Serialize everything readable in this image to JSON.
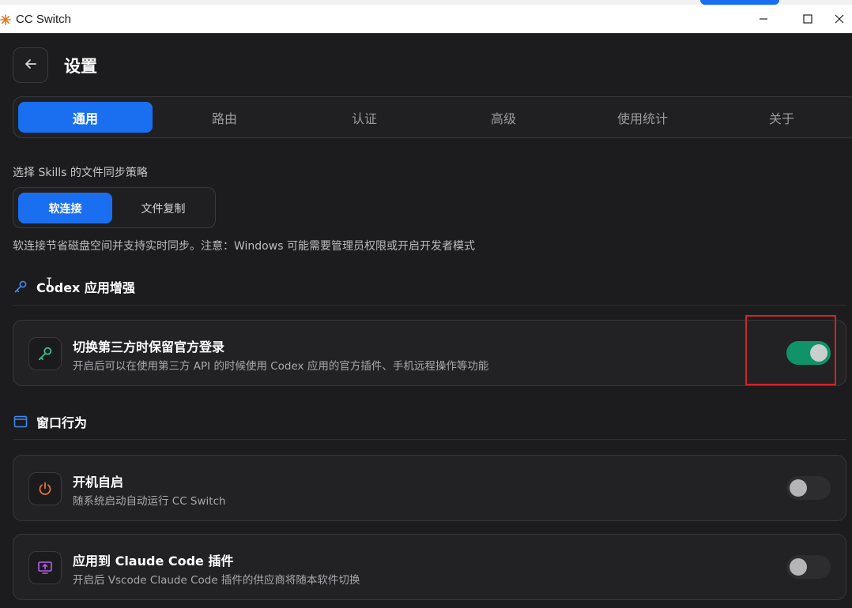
{
  "window": {
    "title": "CC Switch"
  },
  "header": {
    "title": "设置"
  },
  "tabs": [
    {
      "label": "通用",
      "active": true
    },
    {
      "label": "路由",
      "active": false
    },
    {
      "label": "认证",
      "active": false
    },
    {
      "label": "高级",
      "active": false
    },
    {
      "label": "使用统计",
      "active": false
    },
    {
      "label": "关于",
      "active": false
    }
  ],
  "skills_sync": {
    "label": "选择 Skills 的文件同步策略",
    "options": [
      {
        "label": "软连接",
        "selected": true
      },
      {
        "label": "文件复制",
        "selected": false
      }
    ],
    "note": "软连接节省磁盘空间并支持实时同步。注意：Windows 可能需要管理员权限或开启开发者模式"
  },
  "codex_section": {
    "title": "Codex 应用增强",
    "icon": "key-icon",
    "items": [
      {
        "title": "切换第三方时保留官方登录",
        "description": "开启后可以在使用第三方 API 的时候使用 Codex 应用的官方插件、手机远程操作等功能",
        "icon": "key-icon",
        "enabled": true
      }
    ]
  },
  "window_section": {
    "title": "窗口行为",
    "icon": "window-icon",
    "items": [
      {
        "title": "开机自启",
        "description": "随系统启动自动运行 CC Switch",
        "icon": "power-icon",
        "enabled": false
      },
      {
        "title": "应用到 Claude Code 插件",
        "description": "开启后 Vscode Claude Code 插件的供应商将随本软件切换",
        "icon": "monitor-upload-icon",
        "enabled": false
      }
    ]
  },
  "colors": {
    "accent": "#1a6ff0",
    "toggle_on": "#11936a",
    "highlight": "#d2232a",
    "background": "#1c1c1e"
  }
}
